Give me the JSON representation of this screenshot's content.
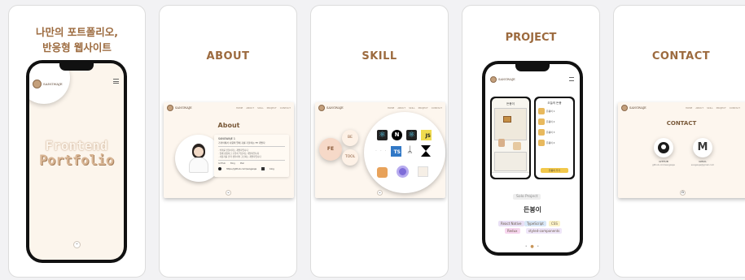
{
  "cards": [
    {
      "heading_line1": "나만의 포트폴리오,",
      "heading_line2": "반응형 웹사이트",
      "logo_text": "SANGWAJE",
      "hero_line1": "Frontend",
      "hero_line2": "Portfolio"
    },
    {
      "heading": "ABOUT",
      "logo_text": "SANGWAJE",
      "nav": [
        "HOME",
        "ABOUT",
        "SKILL",
        "PROJECT",
        "CONTACT"
      ],
      "section_title": "About",
      "intro_name": "SANGWAJE 1",
      "intro_sub": "가까이에서 사람의 말에 귀를 기울이는 FE 개발자",
      "bullets": [
        "· 의미를 만들어가는 개발자입니다",
        "· 함께 성장하고 꾸준히 학습하는 개발자입니다",
        "· 사용자를 먼저 생각하며 고민하는 개발자입니다"
      ],
      "links": [
        "GitHub",
        "Blog",
        "Mail"
      ],
      "footer_left": "https://github.com/sangwaje",
      "footer_right": "blog"
    },
    {
      "heading": "SKILL",
      "logo_text": "SANGWAJE",
      "nav": [
        "HOME",
        "ABOUT",
        "SKILL",
        "PROJECT",
        "CONTACT"
      ],
      "tabs": [
        "FE",
        "BE",
        "TOOL"
      ],
      "logos": [
        "JS",
        "TS"
      ]
    },
    {
      "heading": "PROJECT",
      "logo_text": "SANGWAJE",
      "project_tag": "Solo Project",
      "project_name": "든봉이",
      "tech_tags": [
        "React Native",
        "TypeScript",
        "CSS",
        "Redux",
        "styled-components"
      ],
      "left_phone_title": "든봉이",
      "right_phone_title": "오늘의 든봉",
      "list_items": [
        "든봉이 1",
        "든봉이 2",
        "든봉이 3",
        "든봉이 4"
      ],
      "button_label": "든봉이 추가"
    },
    {
      "heading": "CONTACT",
      "logo_text": "SANGWAJE",
      "nav": [
        "HOME",
        "ABOUT",
        "SKILL",
        "PROJECT",
        "CONTACT"
      ],
      "section_title": "CONTACT",
      "contacts": [
        {
          "label": "GITHUB",
          "sub": "github.com/sangwaje"
        },
        {
          "label": "GMAIL",
          "sub": "sangwaje@gmail.com"
        }
      ]
    }
  ],
  "colors": {
    "accent": "#9c6a3e",
    "background": "#fcf5ec"
  }
}
